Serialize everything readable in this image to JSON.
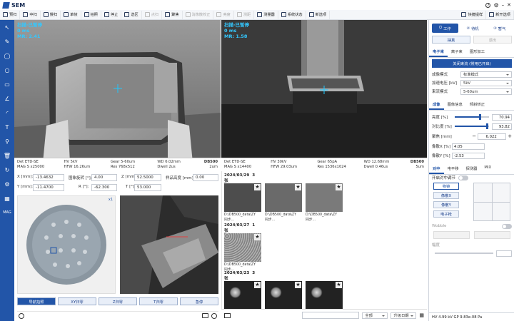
{
  "app": {
    "title": "SEM",
    "right_buttons": [
      "快捷提样",
      "新开选项"
    ]
  },
  "toolbar": [
    {
      "label": "预扫",
      "enabled": true
    },
    {
      "label": "中扫",
      "enabled": true
    },
    {
      "label": "慢扫",
      "enabled": true
    },
    {
      "label": "单帧",
      "enabled": true
    },
    {
      "label": "拍照",
      "enabled": true
    },
    {
      "label": "停止",
      "enabled": true
    },
    {
      "label": "选区",
      "enabled": true
    },
    {
      "label": "点扫",
      "enabled": false
    },
    {
      "label": "聚焦",
      "enabled": true
    },
    {
      "label": "消像散校正",
      "enabled": false
    },
    {
      "label": "亮度",
      "enabled": false
    },
    {
      "label": "测距",
      "enabled": false
    },
    {
      "label": "测量器",
      "enabled": true
    },
    {
      "label": "系统状态",
      "enabled": true
    },
    {
      "label": "新选项",
      "enabled": true
    }
  ],
  "left_tools": [
    "pointer-icon",
    "ruler-icon",
    "ellipse-icon",
    "circle-icon",
    "area-icon",
    "angle-icon",
    "arc-icon",
    "text-icon",
    "stamp-icon",
    "delete-icon",
    "rotate-icon",
    "settings-icon",
    "grid-icon",
    "mag-icon"
  ],
  "left_tools_label": "MAG",
  "viewer1": {
    "overlay_title": "扫描·已暂停",
    "overlay_time": "0 ms",
    "overlay_mr": "MR: 2.41",
    "info": {
      "det": "Det ETD-SE",
      "hv": "HV 5kV",
      "gear": "Gear 5-60um",
      "wd": "WD 6.02mm",
      "brand": "DB500",
      "mag": "MAG S x25000",
      "hfw": "HFW 16.26um",
      "res": "Res 768x512",
      "dwell": "Dwell 2us",
      "scale": "2um"
    }
  },
  "viewer2": {
    "overlay_title": "扫描·已暂停",
    "overlay_time": "0 ms",
    "overlay_mr": "MR: 1.58",
    "info": {
      "det": "Det ETD-SE",
      "hv": "HV 30kV",
      "gear": "Gear 65pA",
      "wd": "WD 12.68mm",
      "brand": "DB500",
      "mag": "MAG S x14400",
      "hfw": "HFW 29.03um",
      "res": "Res 1536x1024",
      "dwell": "Dwell 0.46us",
      "scale": "5um"
    }
  },
  "stage": {
    "x_label": "X [mm]:",
    "x_val": "-13.4632",
    "y_label": "Y [mm]:",
    "y_val": "-11.4700",
    "rot_label": "图象旋转 [°]:",
    "rot_val": "4.00",
    "r_label": "R [°]:",
    "r_val": "-62.300",
    "z_label": "Z [mm]:",
    "z_val": "52.5000",
    "t_label": "T [°]:",
    "t_val": "53.000",
    "tilt_label": "样品高度 [mm]:",
    "tilt_val": "0.00",
    "buttons": [
      "导航拍照",
      "XY归零",
      "Z归零",
      "T归零",
      "急停"
    ],
    "corner": "x1"
  },
  "gallery": {
    "days": [
      {
        "date": "2024/03/29",
        "count": "3张",
        "caps": [
          "D:\\DB500_data\\ZY同步...",
          "D:\\DB500_data\\ZY同步...",
          "D:\\DB500_data\\ZY同步..."
        ]
      },
      {
        "date": "2024/03/27",
        "count": "1张",
        "caps": [
          "D:\\DB500_data\\ZY同步..."
        ]
      },
      {
        "date": "2024/03/23",
        "count": "3张",
        "caps": [
          "",
          "",
          ""
        ]
      }
    ],
    "sort": "全部",
    "sort2": "升级日期"
  },
  "right": {
    "mode_btns": [
      "工作",
      "待机",
      "暂气"
    ],
    "sub_btns": [
      "抽真",
      "退出"
    ],
    "tabs1": [
      "电子束",
      "离子束",
      "图形加工"
    ],
    "beam_btn": "关闭束流 (常用已开启)",
    "rows": [
      {
        "k": "成像模式",
        "v": "标准模式"
      },
      {
        "k": "加速电压 [kV]",
        "v": "5kV"
      },
      {
        "k": "束流模式",
        "v": "5-60um"
      }
    ],
    "tabs2": [
      "成像",
      "图像信息",
      "倾斜矫正"
    ],
    "bright_label": "亮度 [%]",
    "bright_val": "70.94",
    "bright_frac": 0.72,
    "contrast_label": "对比度 [%]",
    "contrast_val": "93.82",
    "contrast_frac": 0.94,
    "focus_label": "聚焦 [mm]",
    "focus_val": "6.022",
    "stigx_label": "像散X [%]",
    "stigx_val": "4.05",
    "stigy_label": "像散Y [%]",
    "stigy_val": "-2.53",
    "tabs3": [
      "对中",
      "电平移",
      "探测器",
      "MIX"
    ],
    "center_label": "开启对中调节",
    "center_btns": [
      "物镜",
      "像散X",
      "像散Y",
      "电子枪"
    ],
    "wobble_label": "Wobble",
    "amp_label": "幅度",
    "status": "HV 4.99 kV   GP 9.83e-08 Pa"
  },
  "colors": {
    "accent": "#2255a8",
    "overlay": "#33c8ff",
    "crosshair": "#1ec8ff"
  }
}
